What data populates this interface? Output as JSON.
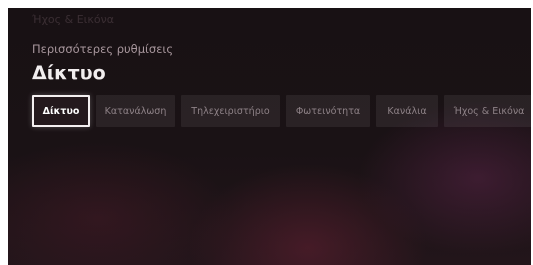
{
  "header": {
    "faded_title": "Ήχος & Εικόνα",
    "subtitle": "Περισσότερες ρυθμίσεις",
    "title": "Δίκτυο"
  },
  "tabs": [
    {
      "label": "Δίκτυο",
      "active": true
    },
    {
      "label": "Κατανάλωση",
      "active": false
    },
    {
      "label": "Τηλεχειριστήριο",
      "active": false
    },
    {
      "label": "Φωτεινότητα",
      "active": false
    },
    {
      "label": "Κανάλια",
      "active": false
    },
    {
      "label": "Ήχος & Εικόνα",
      "active": false
    }
  ],
  "colors": {
    "background": "#1a1215",
    "accent_glow": "#7a2a45",
    "active_tab_border": "#f4f0f1"
  }
}
